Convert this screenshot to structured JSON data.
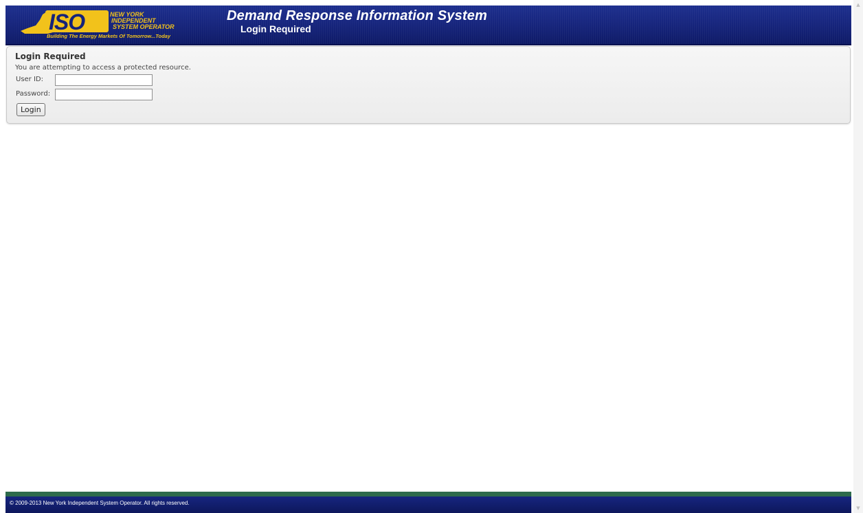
{
  "header": {
    "logo": {
      "mark": "ISO",
      "line1": "NEW YORK",
      "line2": "INDEPENDENT",
      "line3": "SYSTEM OPERATOR",
      "tagline": "Building The Energy Markets Of Tomorrow...Today"
    },
    "title": "Demand Response Information System",
    "subtitle": "Login Required"
  },
  "login": {
    "heading": "Login Required",
    "message": "You are attempting to access a protected resource.",
    "user_label": "User ID:",
    "user_value": "",
    "password_label": "Password:",
    "password_value": "",
    "button_label": "Login"
  },
  "footer": {
    "copyright": "© 2009-2013 New York Independent System Operator. All rights reserved."
  },
  "colors": {
    "header_blue": "#15237a",
    "footer_green": "#2e6b4c",
    "logo_yellow": "#f2c21b"
  },
  "icons": {
    "scroll_up": "chevron-up-icon",
    "scroll_down": "chevron-down-icon"
  }
}
